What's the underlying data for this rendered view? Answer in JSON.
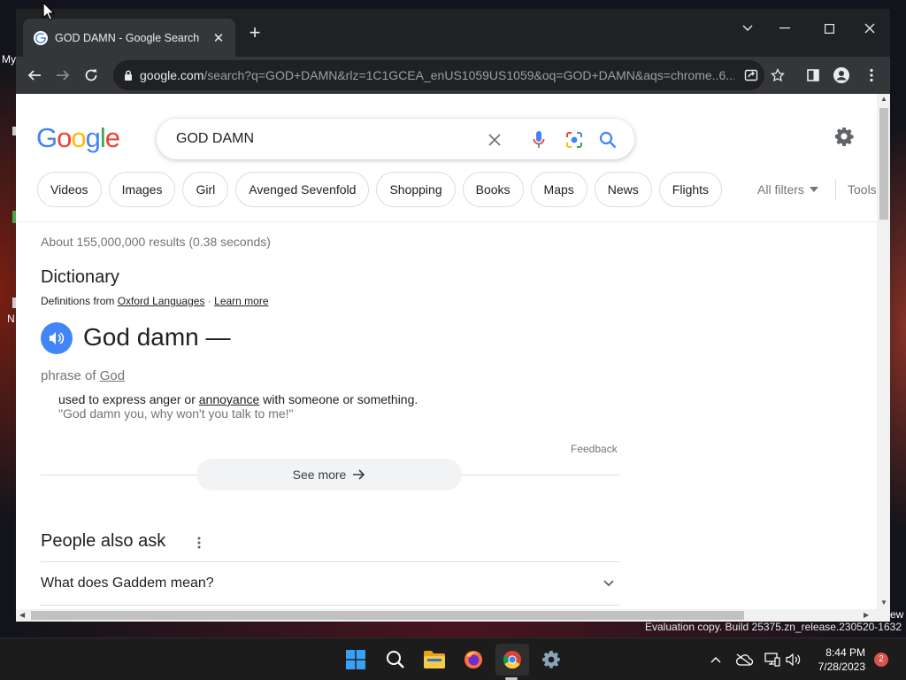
{
  "desktop": {
    "watermark": "Evaluation copy. Build 25375.zn_release.230520-1632",
    "icon_label_1": "My",
    "icon_label_2": "N",
    "icon_label_3": "ew"
  },
  "browser": {
    "tab_title": "GOD DAMN - Google Search",
    "tab_close": "✕",
    "new_tab": "+",
    "url_host": "google.com",
    "url_rest": "/search?q=GOD+DAMN&rlz=1C1GCEA_enUS1059US1059&oq=GOD+DAMN&aqs=chrome..6..."
  },
  "google": {
    "logo_letters": [
      "G",
      "o",
      "o",
      "g",
      "l",
      "e"
    ],
    "logo_colors": [
      "#4285f4",
      "#ea4335",
      "#fbbc05",
      "#4285f4",
      "#34a853",
      "#ea4335"
    ],
    "query": "GOD DAMN",
    "chips": [
      "Videos",
      "Images",
      "Girl",
      "Avenged Sevenfold",
      "Shopping",
      "Books",
      "Maps",
      "News",
      "Flights"
    ],
    "all_filters": "All filters",
    "tools": "Tools",
    "result_stats": "About 155,000,000 results (0.38 seconds)"
  },
  "dictionary": {
    "heading": "Dictionary",
    "source_prefix": "Definitions from",
    "source_link": "Oxford Languages",
    "source_sep": " · ",
    "learn_more": "Learn more",
    "word": "God damn —",
    "pos_prefix": "phrase of",
    "pos_link": "God",
    "def_before": "used to express anger or ",
    "def_link": "annoyance",
    "def_after": " with someone or something.",
    "example": "\"God damn you, why won't you talk to me!\"",
    "feedback": "Feedback",
    "see_more": "See more"
  },
  "people_also_ask": {
    "heading": "People also ask",
    "questions": [
      "What does Gaddem mean?"
    ]
  },
  "taskbar": {
    "time": "8:44 PM",
    "date": "7/28/2023",
    "notification_count": "2"
  },
  "icons": {
    "tab_favicon": "google-favicon-icon",
    "back": "back-arrow-icon",
    "forward": "forward-arrow-icon",
    "reload": "reload-icon",
    "lock": "lock-icon",
    "share": "share-icon",
    "bookmark": "star-icon",
    "side_panel": "side-panel-icon",
    "profile": "profile-icon",
    "menu": "kebab-menu-icon",
    "clear": "close-icon",
    "voice": "mic-icon",
    "lens": "google-lens-icon",
    "search": "search-icon",
    "settings": "gear-icon",
    "speaker": "speaker-icon"
  }
}
